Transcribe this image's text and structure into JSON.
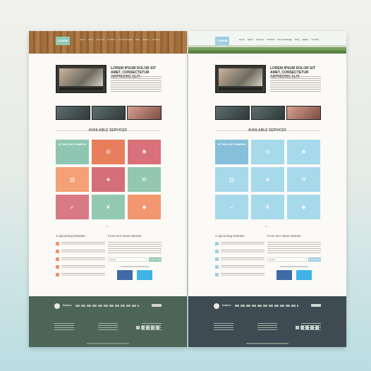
{
  "pages": [
    {
      "id": "wood",
      "logo": "LOREM",
      "nav": [
        "Home",
        "About",
        "Services",
        "Portfolio",
        "Our Knowledge",
        "Blog",
        "Gallery",
        "Contact"
      ],
      "hero_title": "LOREM IPSUM DOLOR SIT AMET, CONSECTETUR ADIPISCING ELIT.",
      "section_title": "AVAILABLE SERVICES",
      "feature_tile_text": "IS THIS JUST PUMPING",
      "upcoming_title": "3 Upcoming Release",
      "news_title": "From Our News Stream",
      "subscribe_placeholder": "Email",
      "subscribe_button": "SUBSCRIBE",
      "footer_name": "Dealers"
    },
    {
      "id": "blue",
      "logo": "LOREM",
      "nav": [
        "Home",
        "About",
        "Services",
        "Portfolio",
        "Our Knowledge",
        "Blog",
        "Gallery",
        "Contact"
      ],
      "hero_title": "LOREM IPSUM DOLOR SIT AMET, CONSECTETUR ADIPISCING ELIT.",
      "section_title": "AVAILABLE SERVICES",
      "feature_tile_text": "IS THIS JUST PUMPING",
      "upcoming_title": "3 Upcoming Release",
      "news_title": "From Our News Stream",
      "subscribe_placeholder": "Email",
      "subscribe_button": "SUBSCRIBE",
      "footer_name": "Dealers"
    }
  ],
  "icons": [
    "gear-icon",
    "settings-icon",
    "trash-icon",
    "tree-icon",
    "recycle-icon",
    "rocket-icon",
    "leaf-icon",
    "drop-icon"
  ],
  "colors": {
    "wood_accent": "#8ec6b3",
    "blue_accent": "#9ccfe3",
    "wood_footer": "#4d6556",
    "blue_footer": "#3e4b52"
  }
}
